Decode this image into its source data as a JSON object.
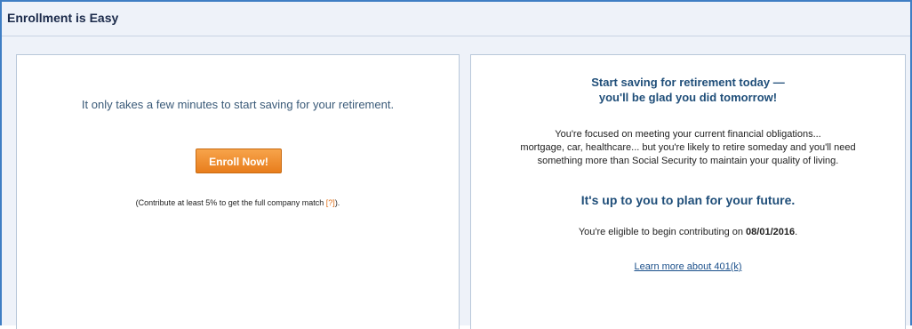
{
  "header": {
    "title": "Enrollment is Easy"
  },
  "left_panel": {
    "intro": "It only takes a few minutes to start saving for your retirement.",
    "button_label": "Enroll Now!",
    "match_note_prefix": "(Contribute at least 5% to get the full company match ",
    "help_link": "[?]",
    "match_note_suffix": ")."
  },
  "right_panel": {
    "headline_line1": "Start saving for retirement today —",
    "headline_line2": "you'll be glad you did tomorrow!",
    "body_line1": "You're focused on meeting your current financial obligations...",
    "body_line2": "mortgage, car, healthcare... but you're likely to retire someday and you'll need",
    "body_line3": "something more than Social Security to maintain your quality of living.",
    "plan_headline": "It's up to you to plan for your future.",
    "eligible_prefix": "You're eligible to begin contributing on ",
    "eligible_date": "08/01/2016",
    "eligible_suffix": ".",
    "learn_more_link": "Learn more about 401(k)"
  },
  "colors": {
    "border_blue": "#3f7ec4",
    "header_bg": "#eef2f9",
    "button_orange": "#e87d1c",
    "headline_blue": "#1f4e79",
    "link_blue": "#1a4f8a",
    "help_orange": "#e0701b"
  }
}
